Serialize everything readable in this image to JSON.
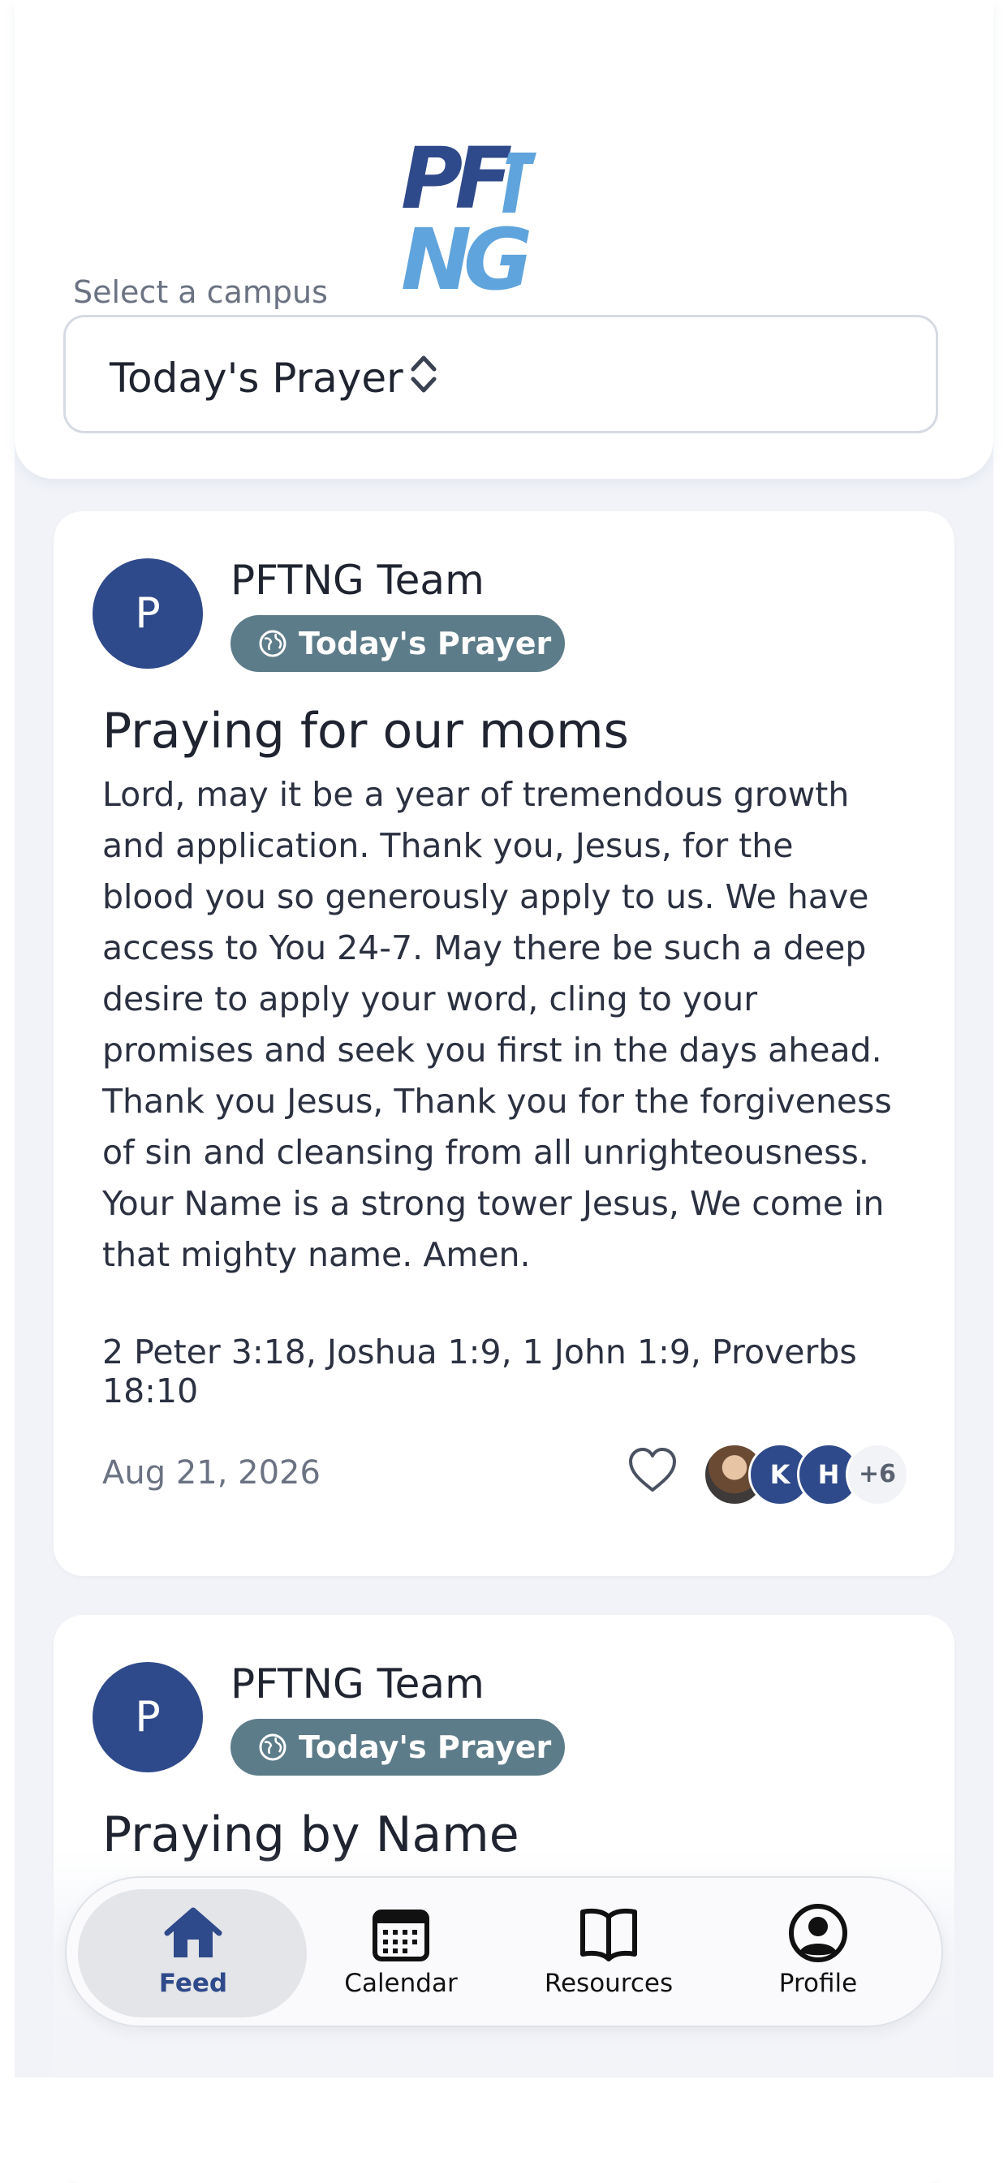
{
  "header": {
    "logo_text_a": "PF",
    "logo_text_b": "NG",
    "campus_label": "Select a campus",
    "campus_value": "Today's Prayer"
  },
  "posts": [
    {
      "avatar_initial": "P",
      "author": "PFTNG Team",
      "badge": "Today's Prayer",
      "title": "Praying for our moms",
      "body_lines": [
        "Lord, may it be a year of tremendous growth",
        "and application. Thank you, Jesus, for the",
        "blood you so generously apply to us. We have",
        "access to You 24-7. May there be such a deep",
        "desire to apply your word, cling to your",
        "promises and seek you first in the days ahead.",
        "Thank you Jesus, Thank you for the forgiveness",
        "of sin and cleansing from all unrighteousness.",
        "Your Name is a strong tower Jesus, We come in",
        "that mighty name. Amen."
      ],
      "references": "2 Peter 3:18, Joshua 1:9, 1 John 1:9, Proverbs 18:10",
      "date": "Aug 21, 2026",
      "reactors": [
        "K",
        "H"
      ],
      "reactors_more": "+6"
    },
    {
      "avatar_initial": "P",
      "author": "PFTNG Team",
      "badge": "Today's Prayer",
      "title": "Praying by Name"
    }
  ],
  "nav": {
    "items": [
      {
        "label": "Feed",
        "icon": "home-icon",
        "active": true
      },
      {
        "label": "Calendar",
        "icon": "calendar-icon"
      },
      {
        "label": "Resources",
        "icon": "book-icon"
      },
      {
        "label": "Profile",
        "icon": "user-circle-icon"
      }
    ]
  },
  "colors": {
    "brand_dark": "#2f4a8a",
    "brand_light": "#5fa4dc",
    "badge": "#5d7c89",
    "feed_bg": "#f1f3f8"
  }
}
